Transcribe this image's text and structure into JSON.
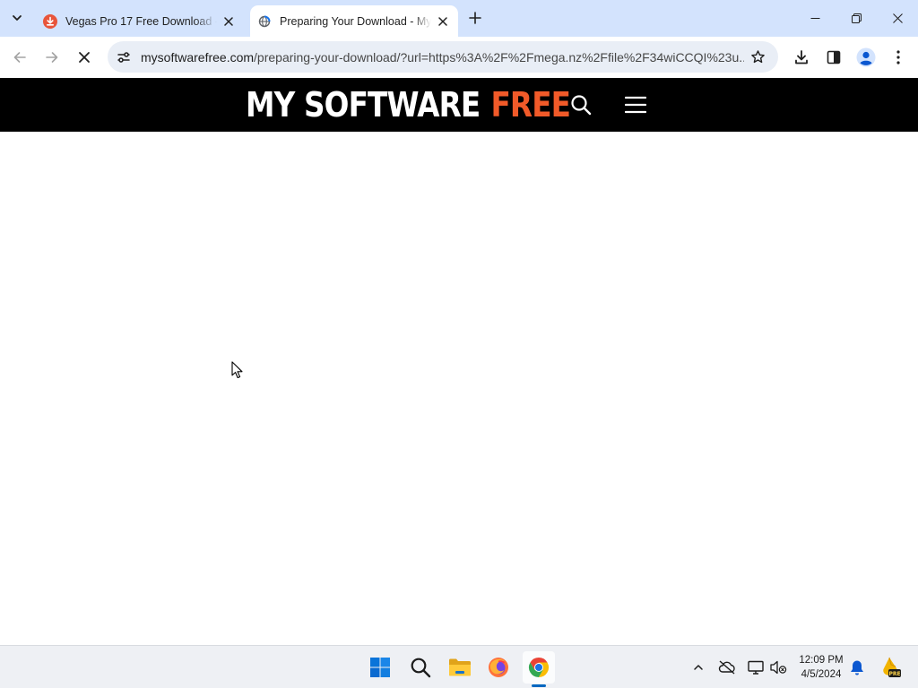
{
  "browser": {
    "tabs": [
      {
        "title": "Vegas Pro 17 Free Download - M",
        "favicon": "download-favicon",
        "active": false
      },
      {
        "title": "Preparing Your Download - My",
        "favicon": "loading-globe-favicon",
        "active": true
      }
    ],
    "address": {
      "host": "mysoftwarefree.com",
      "path": "/preparing-your-download/?url=https%3A%2F%2Fmega.nz%2Ffile%2F34wiCCQI%23u..."
    },
    "loading": true,
    "icons": {
      "tab_search": "chevron-down-icon",
      "new_tab": "plus-icon",
      "minimize": "minimize-icon",
      "restore": "restore-icon",
      "close": "close-icon",
      "back": "back-arrow-icon",
      "forward": "forward-arrow-icon",
      "stop": "stop-x-icon",
      "site_info": "tune-icon",
      "bookmark": "star-icon",
      "downloads": "download-icon",
      "side_panel": "side-panel-icon",
      "profile": "profile-icon",
      "menu": "kebab-menu-icon"
    }
  },
  "site": {
    "logo_white": "MY SOFTWARE",
    "logo_red": "FREE",
    "logo_red_color": "#f15a29",
    "header_bg": "#000000",
    "search_icon": "search-icon",
    "menu_icon": "hamburger-icon"
  },
  "taskbar": {
    "apps": [
      "windows-start-icon",
      "search-icon",
      "file-explorer-icon",
      "firefox-icon",
      "chrome-icon"
    ],
    "tray": [
      "chevron-up-icon",
      "onedrive-offline-icon",
      "display-icon",
      "network-volume-icon",
      "notification-bell-icon",
      "windows-insider-pre-icon"
    ],
    "time": "12:09 PM",
    "date": "4/5/2024",
    "insider_badge": "PRE"
  }
}
